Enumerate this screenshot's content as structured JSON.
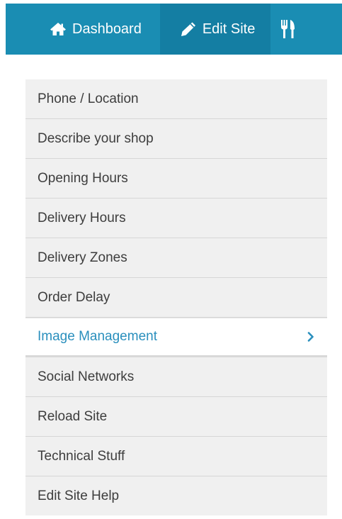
{
  "colors": {
    "nav_background": "#1a8db3",
    "nav_active_background": "#147ea3",
    "menu_background": "#f0f0f0",
    "menu_text": "#3d3d3d",
    "menu_active_text": "#2a8fbd"
  },
  "nav": {
    "items": [
      {
        "label": "Dashboard",
        "icon": "home-icon"
      },
      {
        "label": "Edit Site",
        "icon": "pencil-icon",
        "active": true
      },
      {
        "label": "",
        "icon": "fork-knife-icon"
      }
    ]
  },
  "menu": {
    "items": [
      {
        "label": "Phone / Location"
      },
      {
        "label": "Describe your shop"
      },
      {
        "label": "Opening Hours"
      },
      {
        "label": "Delivery Hours"
      },
      {
        "label": "Delivery Zones"
      },
      {
        "label": "Order Delay"
      },
      {
        "label": "Image Management",
        "active": true,
        "icon": "chevron-right-icon"
      },
      {
        "label": "Social Networks"
      },
      {
        "label": "Reload Site"
      },
      {
        "label": "Technical Stuff"
      },
      {
        "label": "Edit Site Help"
      }
    ]
  }
}
